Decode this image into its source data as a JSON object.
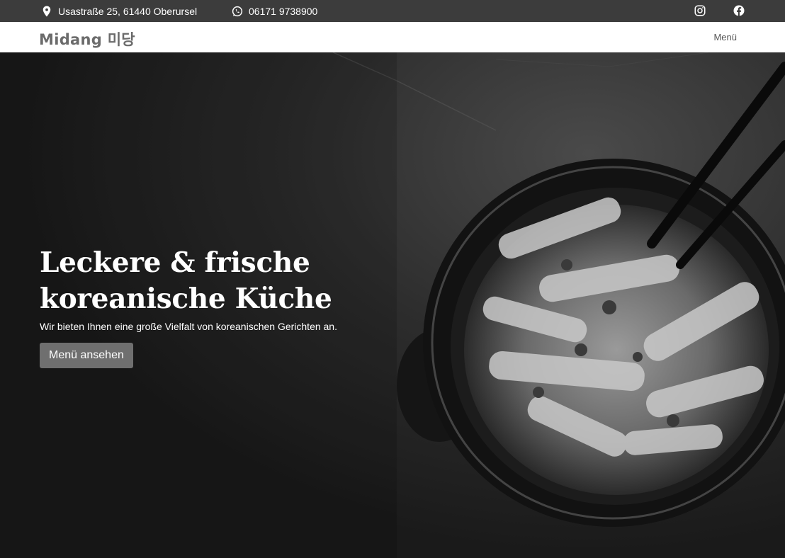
{
  "topbar": {
    "address": "Usastraße 25, 61440 Oberursel",
    "phone": "06171 9738900",
    "address_icon": "map-pin-icon",
    "phone_icon": "whatsapp-icon",
    "social": [
      "instagram-icon",
      "facebook-icon"
    ]
  },
  "navbar": {
    "brand": "Midang 미당",
    "menu_label": "Menü"
  },
  "hero": {
    "title_line1": "Leckere & frische",
    "title_line2": "koreanische Küche",
    "subtitle": "Wir bieten Ihnen eine große Vielfalt von koreanischen Gerichten an.",
    "button_label": "Menü ansehen"
  }
}
